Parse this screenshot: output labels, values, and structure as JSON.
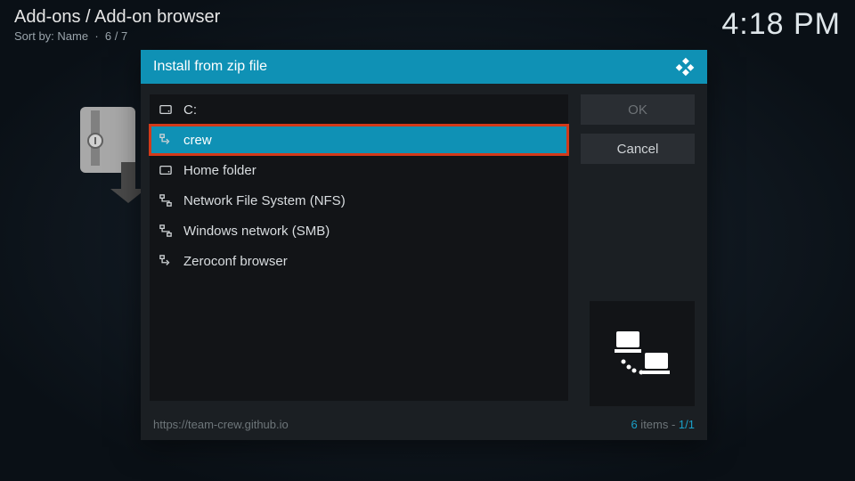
{
  "header": {
    "breadcrumb": "Add-ons / Add-on browser",
    "sort_label": "Sort by: Name",
    "sort_count": "6 / 7",
    "clock": "4:18 PM"
  },
  "dialog": {
    "title": "Install from zip file",
    "buttons": {
      "ok": "OK",
      "cancel": "Cancel"
    },
    "items": [
      {
        "icon": "drive",
        "label": "C:"
      },
      {
        "icon": "netloc",
        "label": "crew",
        "selected": true
      },
      {
        "icon": "drive",
        "label": "Home folder"
      },
      {
        "icon": "net",
        "label": "Network File System (NFS)"
      },
      {
        "icon": "net",
        "label": "Windows network (SMB)"
      },
      {
        "icon": "netloc",
        "label": "Zeroconf browser"
      }
    ],
    "footer": {
      "path": "https://team-crew.github.io",
      "items_count": "6",
      "items_word": " items",
      "page": "1/1"
    }
  }
}
